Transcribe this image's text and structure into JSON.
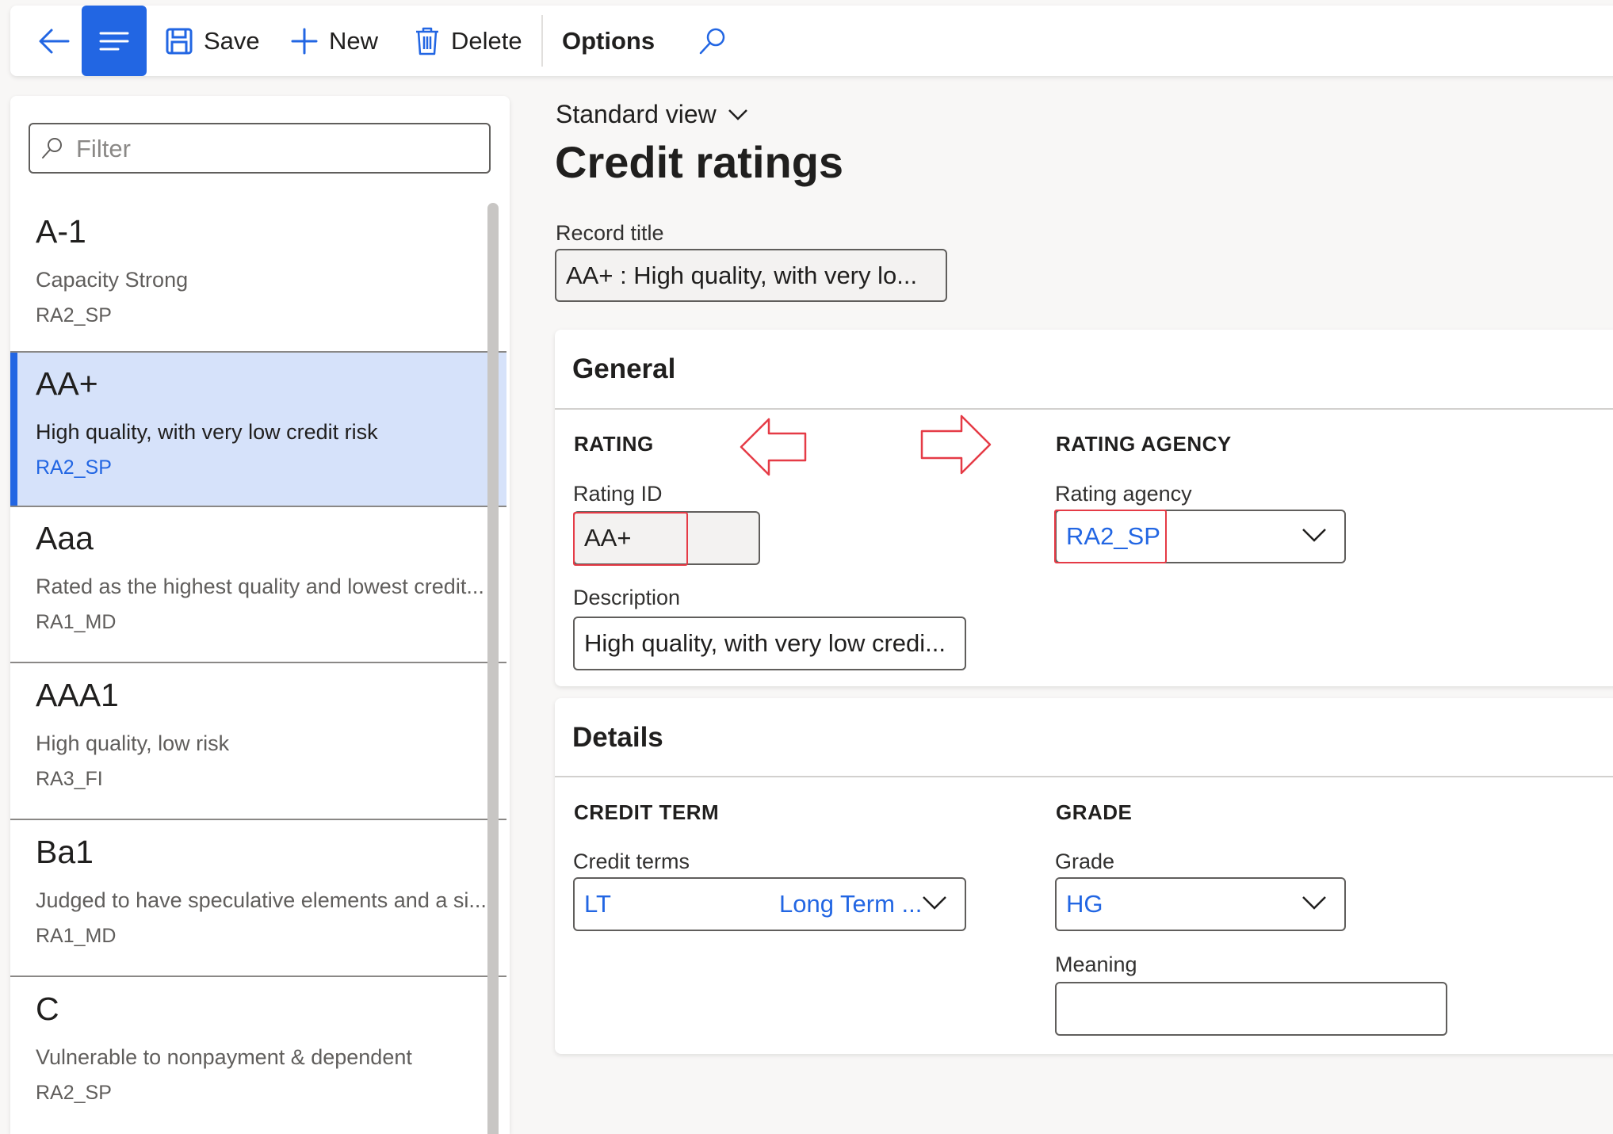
{
  "toolbar": {
    "save_label": "Save",
    "new_label": "New",
    "delete_label": "Delete",
    "options_label": "Options"
  },
  "filter": {
    "placeholder": "Filter"
  },
  "list": [
    {
      "title": "A-1",
      "description": "Capacity Strong",
      "agency": "RA2_SP"
    },
    {
      "title": "AA+",
      "description": "High quality, with very low credit risk",
      "agency": "RA2_SP"
    },
    {
      "title": "Aaa",
      "description": "Rated as the highest quality and lowest credit...",
      "agency": "RA1_MD"
    },
    {
      "title": "AAA1",
      "description": "High quality, low risk",
      "agency": "RA3_FI"
    },
    {
      "title": "Ba1",
      "description": "Judged to have speculative elements and a si...",
      "agency": "RA1_MD"
    },
    {
      "title": "C",
      "description": "Vulnerable to nonpayment & dependent",
      "agency": "RA2_SP"
    }
  ],
  "page": {
    "view_label": "Standard view",
    "title": "Credit ratings",
    "record_title_label": "Record title",
    "record_title_value": "AA+ : High quality, with very lo..."
  },
  "general": {
    "header": "General",
    "rating_group": "RATING",
    "rating_id_label": "Rating ID",
    "rating_id_value": "AA+",
    "description_label": "Description",
    "description_value": "High quality, with very low credi...",
    "agency_group": "RATING AGENCY",
    "agency_label": "Rating agency",
    "agency_value": "RA2_SP"
  },
  "details": {
    "header": "Details",
    "credit_term_group": "CREDIT TERM",
    "credit_terms_label": "Credit terms",
    "credit_terms_code": "LT",
    "credit_terms_desc": "Long Term ...",
    "grade_group": "GRADE",
    "grade_label": "Grade",
    "grade_value": "HG",
    "meaning_label": "Meaning",
    "meaning_value": ""
  },
  "colors": {
    "accent": "#2266e3",
    "selected_row": "#d6e2fa",
    "annotation": "#e53b46"
  }
}
